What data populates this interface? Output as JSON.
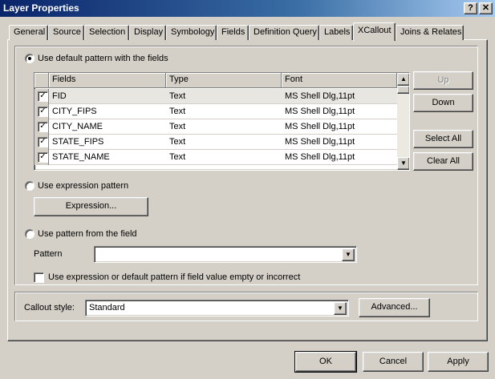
{
  "window": {
    "title": "Layer Properties",
    "help_label": "?",
    "close_label": "✕"
  },
  "tabs": [
    {
      "label": "General",
      "active": false
    },
    {
      "label": "Source",
      "active": false
    },
    {
      "label": "Selection",
      "active": false
    },
    {
      "label": "Display",
      "active": false
    },
    {
      "label": "Symbology",
      "active": false
    },
    {
      "label": "Fields",
      "active": false
    },
    {
      "label": "Definition Query",
      "active": false
    },
    {
      "label": "Labels",
      "active": false
    },
    {
      "label": "XCallout",
      "active": true
    },
    {
      "label": "Joins & Relates",
      "active": false
    }
  ],
  "default_pattern": {
    "label": "Use default pattern with the fields",
    "selected": true,
    "grid": {
      "columns": [
        "Fields",
        "Type",
        "Font"
      ],
      "rows": [
        {
          "field": "FID",
          "type": "Text",
          "font": "MS Shell Dlg,11pt",
          "checked": true
        },
        {
          "field": "CITY_FIPS",
          "type": "Text",
          "font": "MS Shell Dlg,11pt",
          "checked": true
        },
        {
          "field": "CITY_NAME",
          "type": "Text",
          "font": "MS Shell Dlg,11pt",
          "checked": true
        },
        {
          "field": "STATE_FIPS",
          "type": "Text",
          "font": "MS Shell Dlg,11pt",
          "checked": true
        },
        {
          "field": "STATE_NAME",
          "type": "Text",
          "font": "MS Shell Dlg,11pt",
          "checked": true
        }
      ]
    },
    "buttons": {
      "up": "Up",
      "down": "Down",
      "select_all": "Select All",
      "clear_all": "Clear All"
    }
  },
  "expression_pattern": {
    "label": "Use expression pattern",
    "selected": false,
    "button": "Expression..."
  },
  "field_pattern": {
    "label": "Use pattern from the field",
    "selected": false,
    "pattern_label": "Pattern",
    "pattern_value": "",
    "fallback_label": "Use expression or default pattern if field value empty or incorrect",
    "fallback_checked": false
  },
  "callout": {
    "label": "Callout style:",
    "value": "Standard",
    "advanced": "Advanced..."
  },
  "footer": {
    "ok": "OK",
    "cancel": "Cancel",
    "apply": "Apply"
  },
  "colors": {
    "title_gradient_start": "#0a246a",
    "face": "#d4d0c8"
  }
}
